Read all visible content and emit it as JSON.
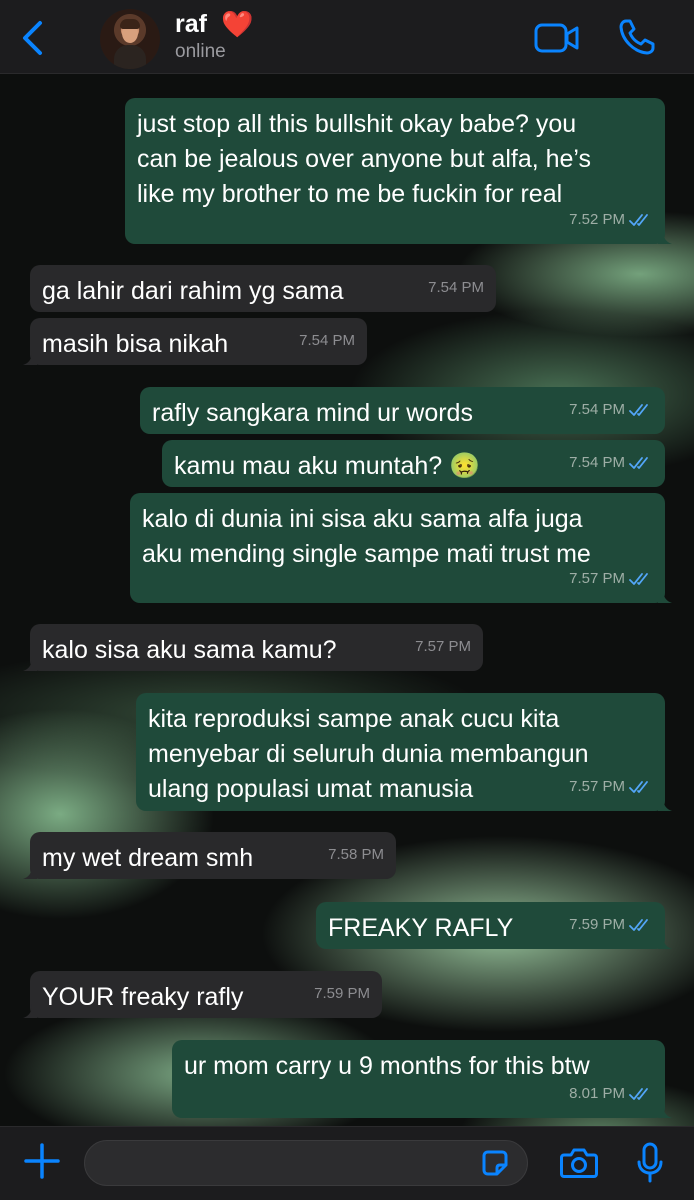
{
  "colors": {
    "accent": "#0a84ff",
    "outgoing_bubble": "#1f4a3a",
    "incoming_bubble": "#29292b",
    "read_ticks": "#53a6f8"
  },
  "header": {
    "contact_name": "raf",
    "contact_emoji": "❤️",
    "status": "online",
    "icons": [
      "back-chevron-icon",
      "video-camera-icon",
      "phone-icon"
    ]
  },
  "messages": [
    {
      "dir": "out",
      "text": "just stop all this bullshit okay babe? you\ncan be jealous over anyone but alfa, he’s\nlike my brother to me be fuckin for real",
      "time": "7.52 PM",
      "read": true
    },
    {
      "dir": "in",
      "text": "ga lahir dari rahim yg sama",
      "time": "7.54 PM"
    },
    {
      "dir": "in",
      "text": "masih bisa nikah",
      "time": "7.54 PM"
    },
    {
      "dir": "out",
      "text": "rafly sangkara mind ur words",
      "time": "7.54 PM",
      "read": true
    },
    {
      "dir": "out",
      "text": "kamu mau aku muntah? 🤢",
      "time": "7.54 PM",
      "read": true
    },
    {
      "dir": "out",
      "text": "kalo di dunia ini sisa aku sama alfa juga\naku mending single sampe mati trust me",
      "time": "7.57 PM",
      "read": true
    },
    {
      "dir": "in",
      "text": "kalo sisa aku sama kamu?",
      "time": "7.57 PM"
    },
    {
      "dir": "out",
      "text": "kita reproduksi sampe anak cucu kita\nmenyebar di seluruh dunia membangun\nulang populasi umat manusia",
      "time": "7.57 PM",
      "read": true
    },
    {
      "dir": "in",
      "text": "my wet dream smh",
      "time": "7.58 PM"
    },
    {
      "dir": "out",
      "text": "FREAKY RAFLY",
      "time": "7.59 PM",
      "read": true
    },
    {
      "dir": "in",
      "text": "YOUR freaky rafly",
      "time": "7.59 PM"
    },
    {
      "dir": "out",
      "text": "ur mom carry u 9 months for this btw",
      "time": "8.01 PM",
      "read": true
    }
  ],
  "input": {
    "placeholder": "",
    "icons": [
      "plus-icon",
      "sticker-icon",
      "camera-icon",
      "microphone-icon"
    ]
  }
}
